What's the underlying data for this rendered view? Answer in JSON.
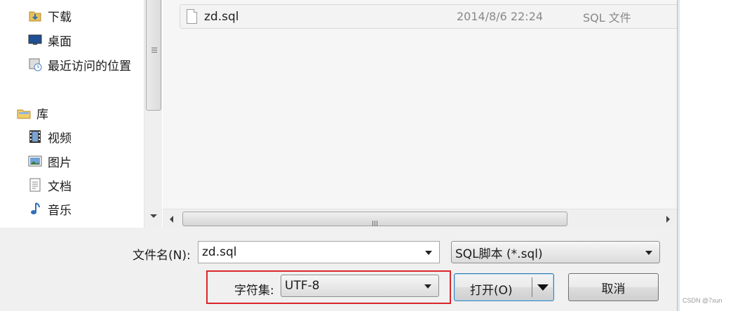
{
  "nav": {
    "items": [
      {
        "label": "下载",
        "icon": "download-folder-icon"
      },
      {
        "label": "桌面",
        "icon": "desktop-icon"
      },
      {
        "label": "最近访问的位置",
        "icon": "recent-places-icon"
      },
      {
        "label": "库",
        "icon": "library-icon"
      },
      {
        "label": "视频",
        "icon": "video-icon"
      },
      {
        "label": "图片",
        "icon": "picture-icon"
      },
      {
        "label": "文档",
        "icon": "document-icon"
      },
      {
        "label": "音乐",
        "icon": "music-icon"
      }
    ]
  },
  "files": [
    {
      "name": "zd.sql",
      "date": "2014/8/6 22:24",
      "type": "SQL 文件"
    }
  ],
  "form": {
    "filename_label": "文件名(N):",
    "filename_value": "zd.sql",
    "filter_value": "SQL脚本 (*.sql)",
    "charset_label": "字符集:",
    "charset_value": "UTF-8",
    "open_label": "打开(O)",
    "cancel_label": "取消"
  },
  "watermark": "CSDN @7xun",
  "colors": {
    "highlight_box": "#d9262b"
  }
}
